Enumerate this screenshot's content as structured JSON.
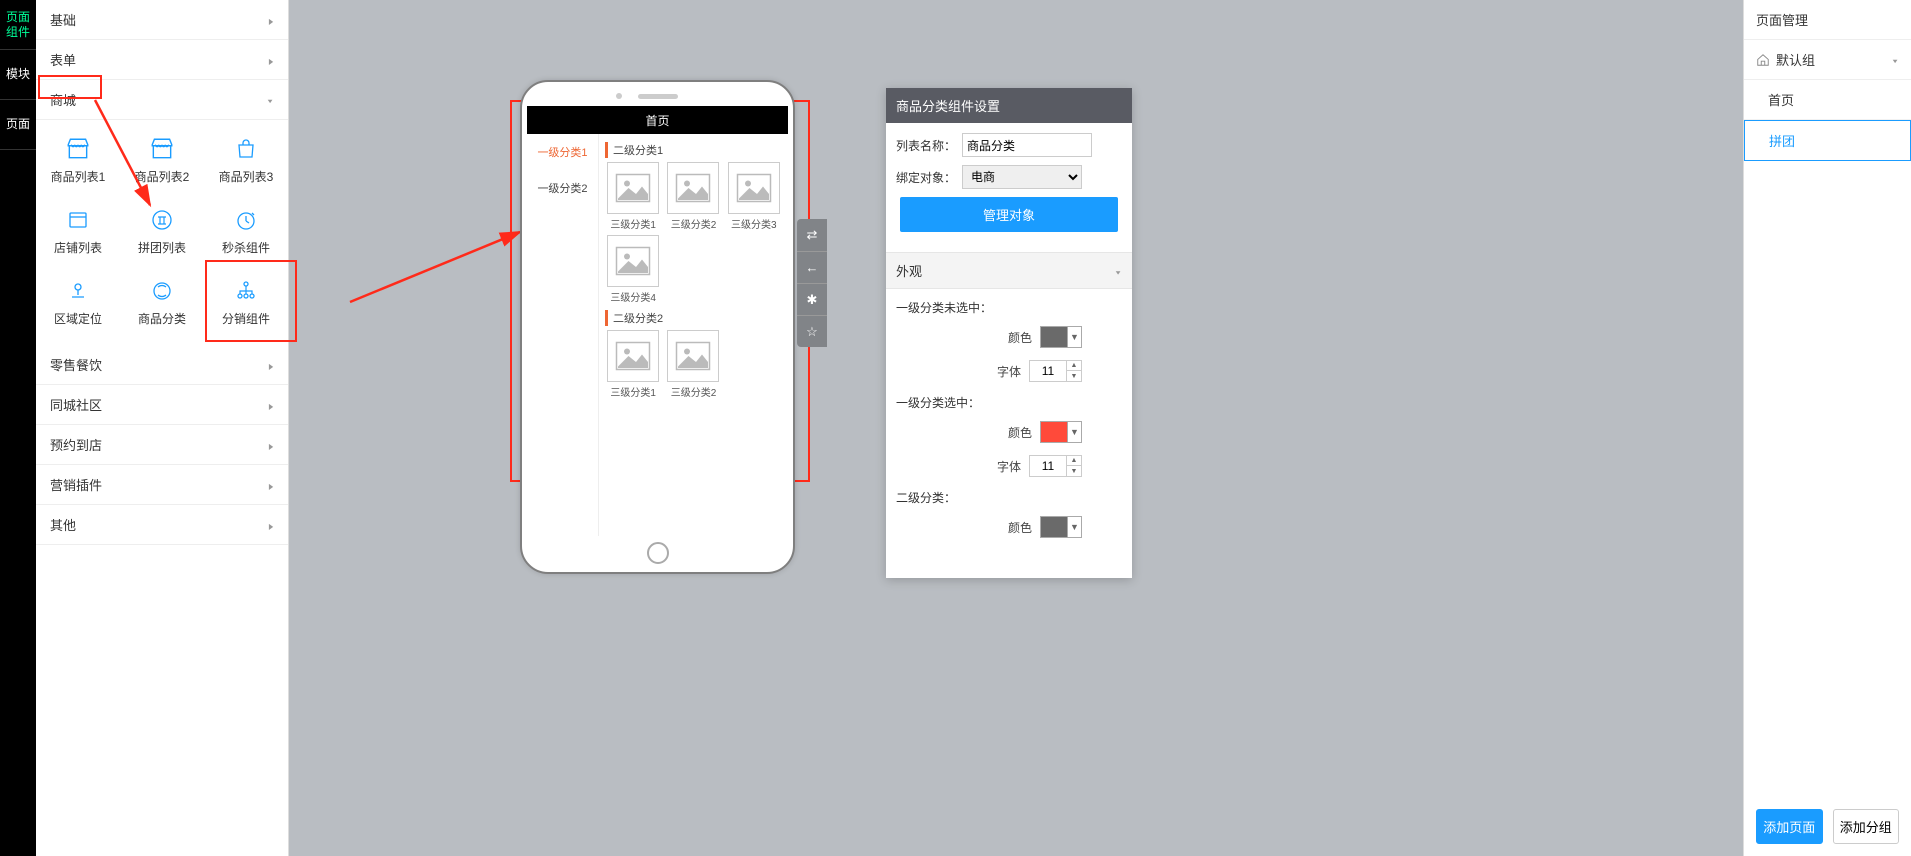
{
  "sidebar_tabs": {
    "t0": "页面组件",
    "t1": "模块",
    "t2": "页面"
  },
  "accordion": {
    "basic": "基础",
    "form": "表单",
    "mall": "商城",
    "retail": "零售餐饮",
    "community": "同城社区",
    "reserve": "预约到店",
    "marketing": "营销插件",
    "other": "其他"
  },
  "components": {
    "c0": "商品列表1",
    "c1": "商品列表2",
    "c2": "商品列表3",
    "c3": "店铺列表",
    "c4": "拼团列表",
    "c5": "秒杀组件",
    "c6": "区域定位",
    "c7": "商品分类",
    "c8": "分销组件"
  },
  "phone": {
    "title": "首页",
    "side": {
      "s0": "一级分类1",
      "s1": "一级分类2"
    },
    "sec1": "二级分类1",
    "sec2": "二级分类2",
    "g": {
      "g0": "三级分类1",
      "g1": "三级分类2",
      "g2": "三级分类3",
      "g3": "三级分类4",
      "g4": "三级分类1",
      "g5": "三级分类2"
    }
  },
  "tools": {
    "t0": "⇄",
    "t1": "←",
    "t2": "✱",
    "t3": "☆"
  },
  "prop": {
    "header": "商品分类组件设置",
    "list_name_label": "列表名称：",
    "list_name_value": "商品分类",
    "bind_label": "绑定对象：",
    "bind_value": "电商",
    "manage_btn": "管理对象",
    "appearance": "外观",
    "sec_unselected": "一级分类未选中：",
    "sec_selected": "一级分类选中：",
    "sec_level2": "二级分类：",
    "color_label": "颜色",
    "font_label": "字体",
    "font_value1": "11",
    "font_value2": "11",
    "color1": "#6a6a6a",
    "color2": "#ff4a3a",
    "color3": "#6a6a6a"
  },
  "page_manager": {
    "title": "页面管理",
    "group": "默认组",
    "p0": "首页",
    "p1": "拼团",
    "add_page": "添加页面",
    "add_group": "添加分组"
  }
}
